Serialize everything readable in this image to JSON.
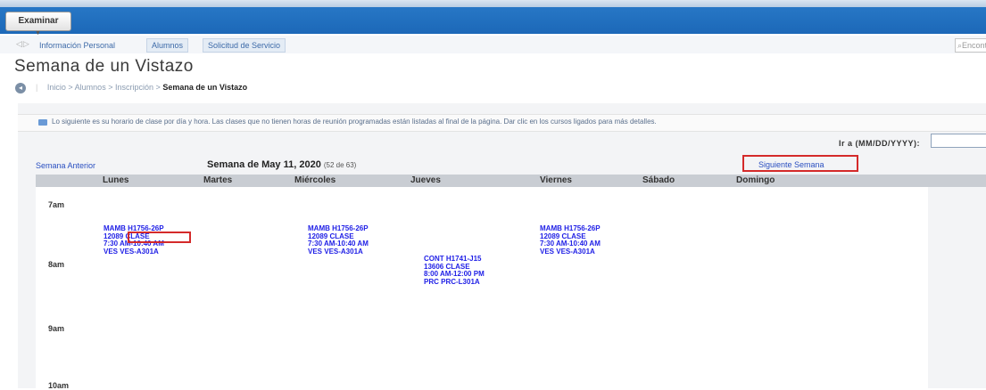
{
  "toolbar": {
    "browse_button": "Examinar"
  },
  "tabs": [
    {
      "label": "Información Personal"
    },
    {
      "label": "Alumnos"
    },
    {
      "label": "Solicitud de Servicio"
    }
  ],
  "search": {
    "placeholder": "Encontrar"
  },
  "page": {
    "title": "Semana de un Vistazo"
  },
  "breadcrumb": {
    "items": [
      "Inicio",
      "Alumnos",
      "Inscripción"
    ],
    "separator": ">",
    "current": "Semana de un Vistazo"
  },
  "info": {
    "text": "Lo siguiente es su horario de clase por día y hora. Las clases que no tienen horas de reunión programadas están listadas al final de la página. Dar clic en los cursos ligados para más detalles."
  },
  "goto": {
    "label": "Ir a (MM/DD/YYYY):",
    "value": ""
  },
  "nav": {
    "prev_week": "Semana Anterior",
    "next_week": "Siguiente Semana",
    "week_title": "Semana de May 11, 2020",
    "week_count": "(52 de 63)"
  },
  "days": [
    "Lunes",
    "Martes",
    "Miércoles",
    "Jueves",
    "Viernes",
    "Sábado",
    "Domingo"
  ],
  "hours": [
    "7am",
    "8am",
    "9am",
    "10am"
  ],
  "classes": [
    {
      "day": "Lunes",
      "lines": [
        "MAMB H1756-26P",
        "12089 CLASE",
        "7:30 AM-10:40 AM",
        "VES VES-A301A"
      ]
    },
    {
      "day": "Miércoles",
      "lines": [
        "MAMB H1756-26P",
        "12089 CLASE",
        "7:30 AM-10:40 AM",
        "VES VES-A301A"
      ]
    },
    {
      "day": "Jueves",
      "lines": [
        "CONT H1741-J15",
        "13606 CLASE",
        "8:00 AM-12:00 PM",
        "PRC PRC-L301A"
      ]
    },
    {
      "day": "Viernes",
      "lines": [
        "MAMB H1756-26P",
        "12089 CLASE",
        "7:30 AM-10:40 AM",
        "VES VES-A301A"
      ]
    }
  ],
  "colors": {
    "topbar": "#1c68b8",
    "link": "#2a4fc0",
    "class_text": "#1e1ee6",
    "highlight": "#d42a2a"
  }
}
